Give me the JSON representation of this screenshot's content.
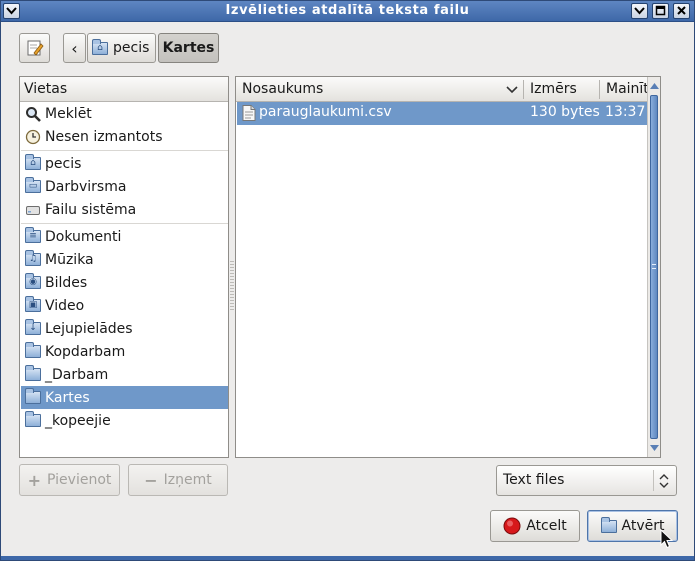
{
  "window": {
    "title": "Izvēlieties atdalītā teksta failu"
  },
  "path_bar": {
    "edit_icon": "pencil-icon",
    "back_label": "‹",
    "crumbs": [
      {
        "label": "pecis",
        "icon": "home-folder-icon"
      },
      {
        "label": "Kartes"
      }
    ]
  },
  "places": {
    "header": "Vietas",
    "items": [
      {
        "label": "Meklēt",
        "icon": "search-icon"
      },
      {
        "label": "Nesen izmantots",
        "icon": "clock-icon"
      },
      {
        "label": "pecis",
        "icon": "home-folder-icon"
      },
      {
        "label": "Darbvirsma",
        "icon": "desktop-folder-icon"
      },
      {
        "label": "Failu sistēma",
        "icon": "drive-icon"
      },
      {
        "label": "Dokumenti",
        "icon": "documents-folder-icon"
      },
      {
        "label": "Mūzika",
        "icon": "music-folder-icon"
      },
      {
        "label": "Bildes",
        "icon": "pictures-folder-icon"
      },
      {
        "label": "Video",
        "icon": "video-folder-icon"
      },
      {
        "label": "Lejupielādes",
        "icon": "downloads-folder-icon"
      },
      {
        "label": "Kopdarbam",
        "icon": "folder-icon"
      },
      {
        "label": "_Darbam",
        "icon": "folder-icon"
      },
      {
        "label": "Kartes",
        "icon": "folder-icon",
        "selected": true
      },
      {
        "label": "_kopeejie",
        "icon": "folder-icon"
      }
    ],
    "add_button": "Pievienot",
    "remove_button": "Izņemt"
  },
  "files": {
    "columns": {
      "name": "Nosaukums",
      "size": "Izmērs",
      "modified": "Mainīts"
    },
    "rows": [
      {
        "name": "parauglaukumi.csv",
        "size": "130 bytes",
        "modified": "13:37",
        "selected": true
      }
    ]
  },
  "filter": {
    "selected": "Text files"
  },
  "actions": {
    "cancel": "Atcelt",
    "open": "Atvērt"
  },
  "colors": {
    "selection": "#6f98c9",
    "titlebar": "#4a74b4",
    "cancel_icon": "#d7181b"
  }
}
